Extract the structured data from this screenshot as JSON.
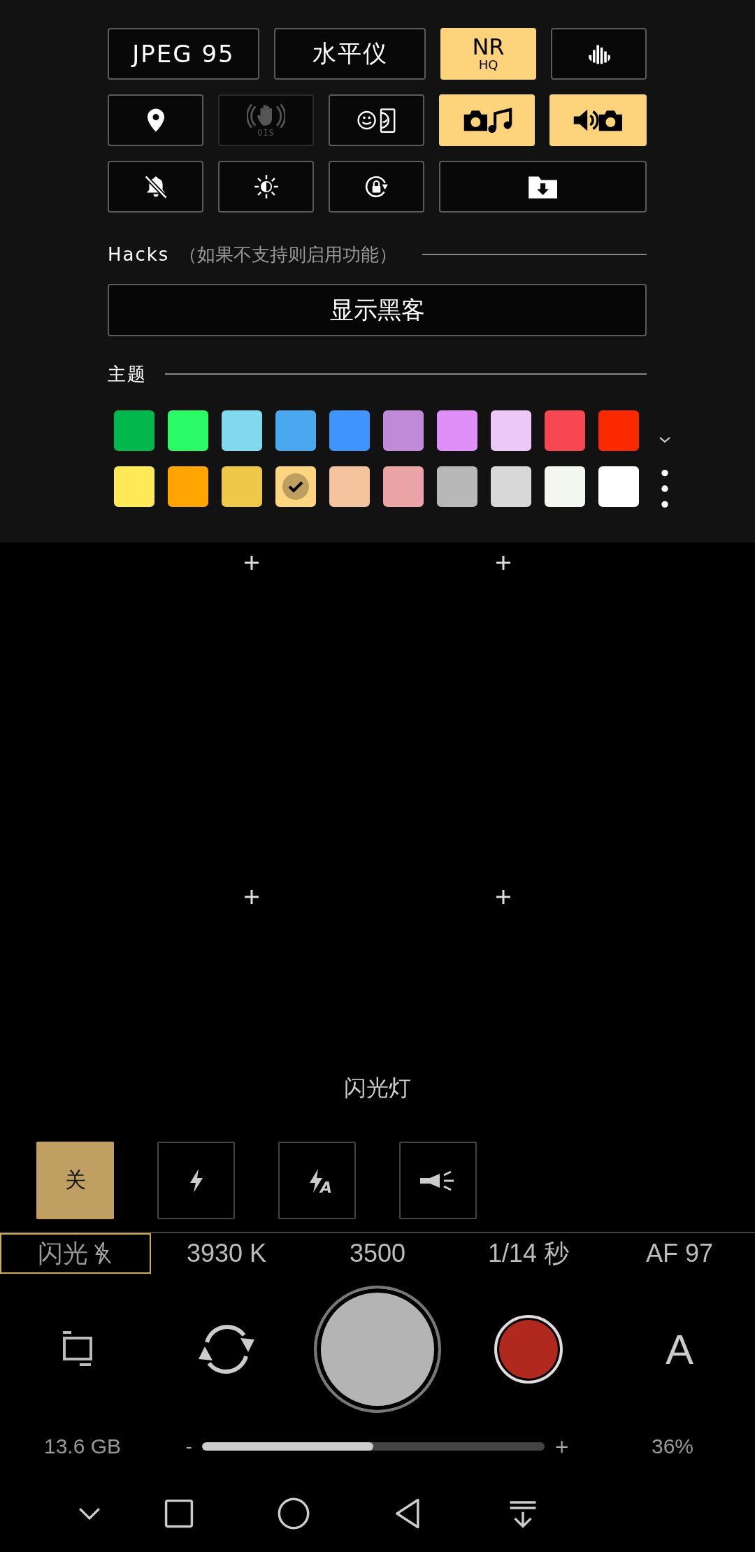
{
  "quick_settings": [
    [
      {
        "kind": "text",
        "label": "JPEG 95",
        "on": false,
        "disabled": false
      },
      {
        "kind": "text",
        "label": "水平仪",
        "on": false,
        "disabled": false
      },
      {
        "kind": "text",
        "label": "NR",
        "sublabel": "HQ",
        "on": true,
        "disabled": false
      },
      {
        "kind": "icon",
        "on": false,
        "disabled": false
      }
    ],
    [
      {
        "kind": "icon",
        "on": false,
        "disabled": false
      },
      {
        "kind": "icon",
        "label": "OIS",
        "on": false,
        "disabled": true
      },
      {
        "kind": "icon",
        "on": false,
        "disabled": false
      },
      {
        "kind": "icon",
        "on": true,
        "disabled": false
      },
      {
        "kind": "icon",
        "on": true,
        "disabled": false
      }
    ],
    [
      {
        "kind": "icon",
        "on": false,
        "disabled": false
      },
      {
        "kind": "icon",
        "on": false,
        "disabled": false
      },
      {
        "kind": "icon",
        "on": false,
        "disabled": false
      },
      {
        "kind": "icon",
        "on": false,
        "disabled": false
      }
    ]
  ],
  "hacks": {
    "title": "Hacks",
    "note": "（如果不支持则启用功能）",
    "button": "显示黑客"
  },
  "theme": {
    "title": "主题",
    "rows": [
      [
        {
          "color": "#00b84e",
          "selected": false
        },
        {
          "color": "#2cfb68",
          "selected": false
        },
        {
          "color": "#80d9ef",
          "selected": false
        },
        {
          "color": "#4aa8f0",
          "selected": false
        },
        {
          "color": "#3f95fb",
          "selected": false
        },
        {
          "color": "#c08ad8",
          "selected": false
        },
        {
          "color": "#e08ff9",
          "selected": false
        },
        {
          "color": "#ebc8f6",
          "selected": false
        },
        {
          "color": "#f74752",
          "selected": false
        },
        {
          "color": "#fb2900",
          "selected": false
        }
      ],
      [
        {
          "color": "#ffe957",
          "selected": false
        },
        {
          "color": "#ffa400",
          "selected": false
        },
        {
          "color": "#efc84a",
          "selected": false
        },
        {
          "color": "#fdd580",
          "selected": true
        },
        {
          "color": "#f5c49e",
          "selected": false
        },
        {
          "color": "#eaa4a5",
          "selected": false
        },
        {
          "color": "#b8b8b8",
          "selected": false
        },
        {
          "color": "#d8d8d8",
          "selected": false
        },
        {
          "color": "#f4f6f0",
          "selected": false
        },
        {
          "color": "#ffffff",
          "selected": false
        }
      ]
    ]
  },
  "flash": {
    "title": "闪光灯",
    "modes": [
      {
        "kind": "text",
        "label": "关",
        "selected": true
      },
      {
        "kind": "flash",
        "selected": false
      },
      {
        "kind": "flash-auto",
        "label": "A",
        "selected": false
      },
      {
        "kind": "torch",
        "selected": false
      }
    ]
  },
  "readings": [
    {
      "kind": "flash",
      "label": "闪光",
      "selected": true
    },
    {
      "kind": "text",
      "label": "3930 K",
      "selected": false
    },
    {
      "kind": "text",
      "label": "3500",
      "selected": false
    },
    {
      "kind": "text",
      "label": "1/14 秒",
      "selected": false
    },
    {
      "kind": "text",
      "label": "AF 97",
      "selected": false
    }
  ],
  "mode_button": "A",
  "storage": "13.6 GB",
  "zoom": {
    "minus": "-",
    "plus": "+",
    "level": 0.5
  },
  "battery": "36%"
}
